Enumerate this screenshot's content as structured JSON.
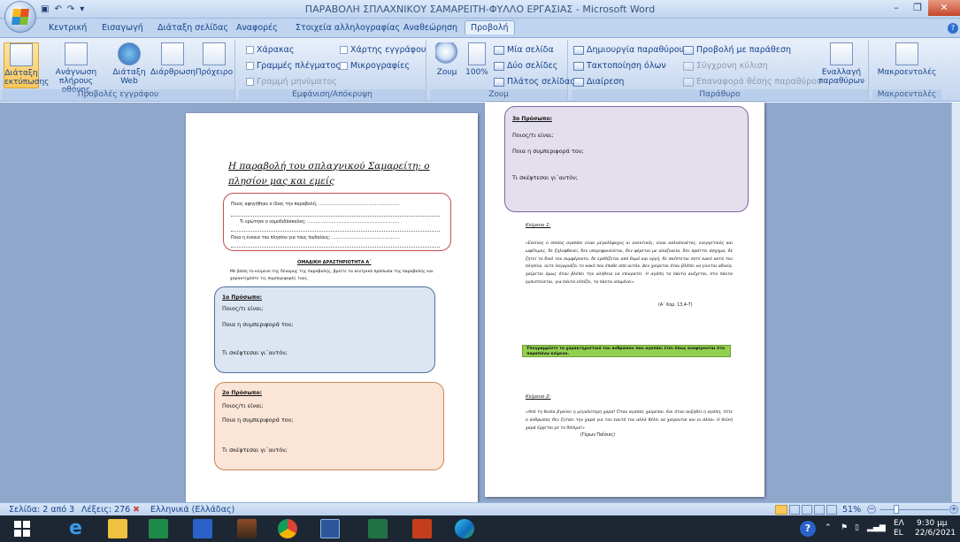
{
  "window": {
    "title": "ΠΑΡΑΒΟΛΗ ΣΠΛΑΧΝΙΚΟΥ ΣΑΜΑΡΕΙΤΗ-ΦΥΛΛΟ ΕΡΓΑΣΙΑΣ - Microsoft Word",
    "minimize": "–",
    "maximize": "❐",
    "close": "✕"
  },
  "tabs": [
    "Κεντρική",
    "Εισαγωγή",
    "Διάταξη σελίδας",
    "Αναφορές",
    "Στοιχεία αλληλογραφίας",
    "Αναθεώρηση",
    "Προβολή"
  ],
  "active_tab": "Προβολή",
  "ribbon": {
    "views_group": {
      "label": "Προβολές εγγράφου",
      "print_layout": "Διάταξη εκτύπωσης",
      "full_screen": "Ανάγνωση πλήρους οθόνης",
      "web_layout": "Διάταξη Web",
      "outline": "Διάρθρωση",
      "draft": "Πρόχειρο"
    },
    "show_group": {
      "label": "Εμφάνιση/Απόκρυψη",
      "ruler": "Χάρακας",
      "gridlines": "Γραμμές πλέγματος",
      "message_bar": "Γραμμή μηνύματος",
      "doc_map": "Χάρτης εγγράφου",
      "thumbnails": "Μικρογραφίες"
    },
    "zoom_group": {
      "label": "Ζουμ",
      "zoom": "Ζουμ",
      "hundred": "100%",
      "one_page": "Μία σελίδα",
      "two_pages": "Δύο σελίδες",
      "page_width": "Πλάτος σελίδας"
    },
    "window_group": {
      "label": "Παράθυρο",
      "new_window": "Δημιουργία παραθύρου",
      "arrange_all": "Τακτοποίηση όλων",
      "split": "Διαίρεση",
      "side_by_side": "Προβολή με παράθεση",
      "sync_scroll": "Σύγχρονη κύλιση",
      "reset_position": "Επαναφορά θέσης παραθύρου",
      "switch_windows": "Εναλλαγή παραθύρων"
    },
    "macros_group": {
      "label": "Μακροεντολές",
      "macros": "Μακροεντολές"
    }
  },
  "document": {
    "page1": {
      "title": "Η παραβολή του σπλαχνικού Σαμαρείτη: ο πλησίον μας και εμείς",
      "box_lines": [
        "Ποιος αφηγήθηκε ο ίδιος την παραβολή; ............................................................",
        "Τι ερώτησε ο νομοδιδάσκαλος; ....................................................................",
        "Ποια η έννοια του πλησίον για τους Ιουδαίους; ..................................................."
      ],
      "activity_heading": "ΟΜΑΔΙΚΗ ΔΡΑΣΤΗΡΙΟΤΗΤΑ Α΄",
      "activity_text": "Με βάση το κείμενο της δύναμης της παραβολής, βρείτε τα κεντρικά πρόσωπα της παραβολής και χαρακτηρίστε τις συμπεριφορές τους.",
      "person1": {
        "heading": "1ο Πρόσωπο:",
        "who": "Ποιος/τι είναι;",
        "behavior": "Ποια η συμπεριφορά του;",
        "think": "Τι σκέφτεσαι γι΄αυτόν;"
      },
      "person2": {
        "heading": "2ο Πρόσωπο:",
        "who": "Ποιος/τι είναι;",
        "behavior": "Ποια η συμπεριφορά του;",
        "think": "Τι σκέφτεσαι γι΄αυτόν;"
      }
    },
    "page2": {
      "person3": {
        "heading": "3ο Πρόσωπο:",
        "who": "Ποιος/τι είναι;",
        "behavior": "Ποια η συμπεριφορά του;",
        "think": "Τι σκέφτεσαι γι΄αυτόν;"
      },
      "text1_heading": "Κείμενο 1:",
      "text1_body": "«Εκείνος ο οποίος αγαπάει είναι μεγαλόψυχος κι ανεκτικός, είναι καλοσυνάτος, ευεργετικός και ωφέλιμος, δε ζηλοφθονεί, δεν υπερηφανεύεται, δεν φέρεται με αλαζονεία, δεν πράττει άσχημα, δε ζητεί το δικό του συμφέροντο, δε ερεθίζεται από θυμό και οργή, δε σκέπτεται ποτέ κακό κατά του πλησίον, ούτε λογαριάζει το κακό που έπαθε από αυτόν. Δεν χαίρεται όταν βλέπει να γίνεται αδικία, χαίρεται όμως όταν βλέπει την αλήθεια να επικρατεί. Η αγάπη τα πάντα ανέχεται, στα πάντα εμπιστεύεται, για πάντα ελπίζει, τα πάντα υπομένει».",
      "text1_ref": "(Α΄ Κορ. 13,4-7)",
      "highlight": "Υπογραμμίστε τα χαρακτηριστικά του ανθρώπου που αγαπάει έτσι όπως αναφέρονται στο παραπάνω κείμενο.",
      "text2_heading": "Κείμενο 2:",
      "text2_body": "«Από τη θυσία βγαίνει η μεγαλύτερη χαρά! Όταν αγαπάς χαίρεσαι. Και όταν αυξηθεί η αγάπη, τότε ο άνθρωπος δεν ζητάει την χαρά για τον εαυτό του αλλά θέλει να χαίρονται και οι άλλοι. Η θεϊκή χαρά έρχεται με το δόσιμο!»",
      "text2_ref": "(Γέρων Παΐσιος)"
    }
  },
  "statusbar": {
    "page": "Σελίδα: 2 από 3",
    "words": "Λέξεις: 276",
    "language": "Ελληνικά (Ελλάδας)",
    "zoom": "51%"
  },
  "taskbar": {
    "lang": "ΕΛ",
    "lang_sub": "EL",
    "time": "9:30 μμ",
    "date": "22/6/2021"
  },
  "colors": {
    "ribbon_bg": "#cddcf1",
    "workspace_bg": "#90a7cc",
    "box_red": "#c0504d",
    "box_blue_bg": "#dce6f2",
    "box_orange_bg": "#fbe5d6",
    "box_purple_bg": "#e4dfec",
    "highlight_green": "#92d050"
  }
}
